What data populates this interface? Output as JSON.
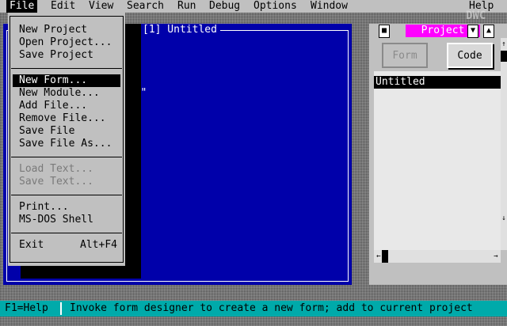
{
  "menubar": {
    "items": [
      "File",
      "Edit",
      "View",
      "Search",
      "Run",
      "Debug",
      "Options",
      "Window",
      "Help"
    ],
    "active_index": 0
  },
  "code_window": {
    "title": "[1] Untitled",
    "text": "ARE\""
  },
  "file_menu": {
    "items": [
      {
        "label": "New Project",
        "shortcut": "",
        "state": "normal"
      },
      {
        "label": "Open Project...",
        "shortcut": "",
        "state": "normal"
      },
      {
        "label": "Save Project",
        "shortcut": "",
        "state": "normal"
      },
      {
        "label": "New Form...",
        "shortcut": "",
        "state": "selected"
      },
      {
        "label": "New Module...",
        "shortcut": "",
        "state": "normal"
      },
      {
        "label": "Add File...",
        "shortcut": "",
        "state": "normal"
      },
      {
        "label": "Remove File...",
        "shortcut": "",
        "state": "normal"
      },
      {
        "label": "Save File",
        "shortcut": "",
        "state": "normal"
      },
      {
        "label": "Save File As...",
        "shortcut": "",
        "state": "normal"
      },
      {
        "label": "Load Text...",
        "shortcut": "",
        "state": "disabled"
      },
      {
        "label": "Save Text...",
        "shortcut": "",
        "state": "disabled"
      },
      {
        "label": "Print...",
        "shortcut": "",
        "state": "normal"
      },
      {
        "label": "MS-DOS Shell",
        "shortcut": "",
        "state": "normal"
      },
      {
        "label": "Exit",
        "shortcut": "Alt+F4",
        "state": "normal"
      }
    ]
  },
  "project_window": {
    "title": "Project",
    "form_button": "Form",
    "code_button": "Code",
    "files": [
      "Untitled"
    ]
  },
  "status_bar": {
    "help": "F1=Help",
    "message": "Invoke form designer to create a new form; add to current project"
  },
  "logo_text": "DWC",
  "icons": {
    "window_close": "square-icon",
    "minimize": "down-triangle-icon",
    "maximize": "up-triangle-icon",
    "scroll_up": "up-arrow-icon",
    "scroll_down": "down-arrow-icon",
    "scroll_left": "left-arrow-icon",
    "scroll_right": "right-arrow-icon"
  },
  "colors": {
    "menu_bg": "#c0c0c0",
    "code_window_bg": "#0000aa",
    "project_title_bg": "#ff00ff",
    "status_bg": "#00aaaa",
    "selection_bg": "#000000"
  }
}
